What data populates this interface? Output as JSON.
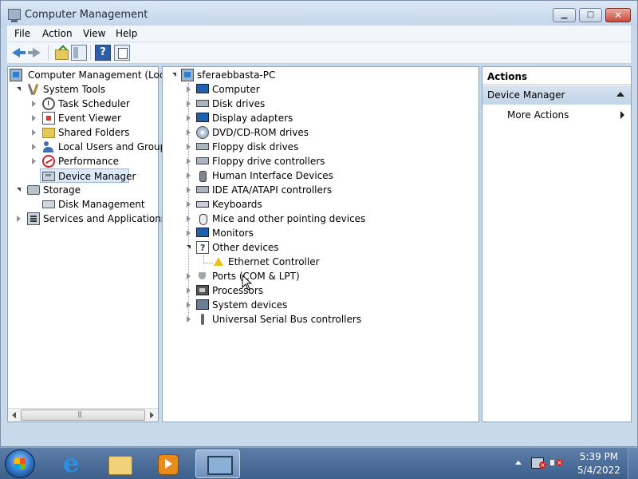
{
  "window": {
    "title": "Computer Management",
    "min_glyph": "▁",
    "max_glyph": "□",
    "close_glyph": "✕"
  },
  "menu": [
    "File",
    "Action",
    "View",
    "Help"
  ],
  "toolbar": {
    "help_glyph": "?"
  },
  "left_tree": {
    "root": "Computer Management (Local",
    "system_tools": "System Tools",
    "system_tools_children": [
      "Task Scheduler",
      "Event Viewer",
      "Shared Folders",
      "Local Users and Groups",
      "Performance",
      "Device Manager"
    ],
    "storage": "Storage",
    "disk_management": "Disk Management",
    "services": "Services and Applications",
    "selected": "Device Manager"
  },
  "device_tree": {
    "root": "sferaebbasta-PC",
    "categories": [
      "Computer",
      "Disk drives",
      "Display adapters",
      "DVD/CD-ROM drives",
      "Floppy disk drives",
      "Floppy drive controllers",
      "Human Interface Devices",
      "IDE ATA/ATAPI controllers",
      "Keyboards",
      "Mice and other pointing devices",
      "Monitors",
      "Other devices",
      "Ports (COM & LPT)",
      "Processors",
      "System devices",
      "Universal Serial Bus controllers"
    ],
    "other_devices_child": "Ethernet Controller"
  },
  "actions": {
    "header": "Actions",
    "section": "Device Manager",
    "more": "More Actions"
  },
  "taskbar": {
    "time": "5:39 PM",
    "date": "5/4/2022"
  }
}
